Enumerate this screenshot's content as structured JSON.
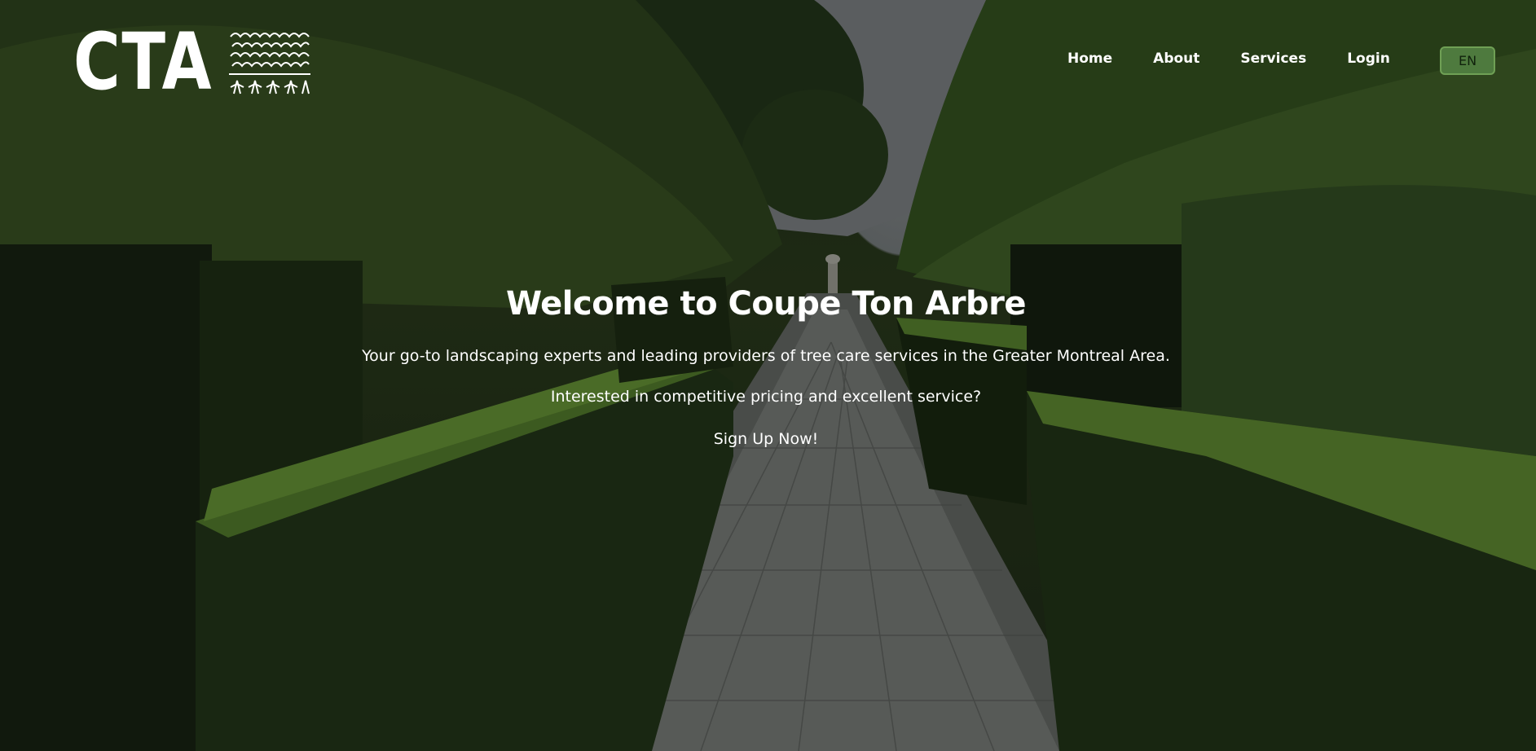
{
  "brand": {
    "logo_text": "CTA",
    "name": "Coupe Ton Arbre"
  },
  "nav": {
    "items": [
      {
        "label": "Home"
      },
      {
        "label": "About"
      },
      {
        "label": "Services"
      },
      {
        "label": "Login"
      }
    ],
    "language": "EN"
  },
  "hero": {
    "title": "Welcome to Coupe Ton Arbre",
    "subtitle": "Your go-to landscaping experts and leading providers of tree care services in the Greater Montreal Area.",
    "question": "Interested in competitive pricing and excellent service?",
    "cta": "Sign Up Now!"
  },
  "colors": {
    "accent_green": "#4e7a3e",
    "text": "#ffffff"
  },
  "icons": [
    "hedge-logo-icon"
  ]
}
